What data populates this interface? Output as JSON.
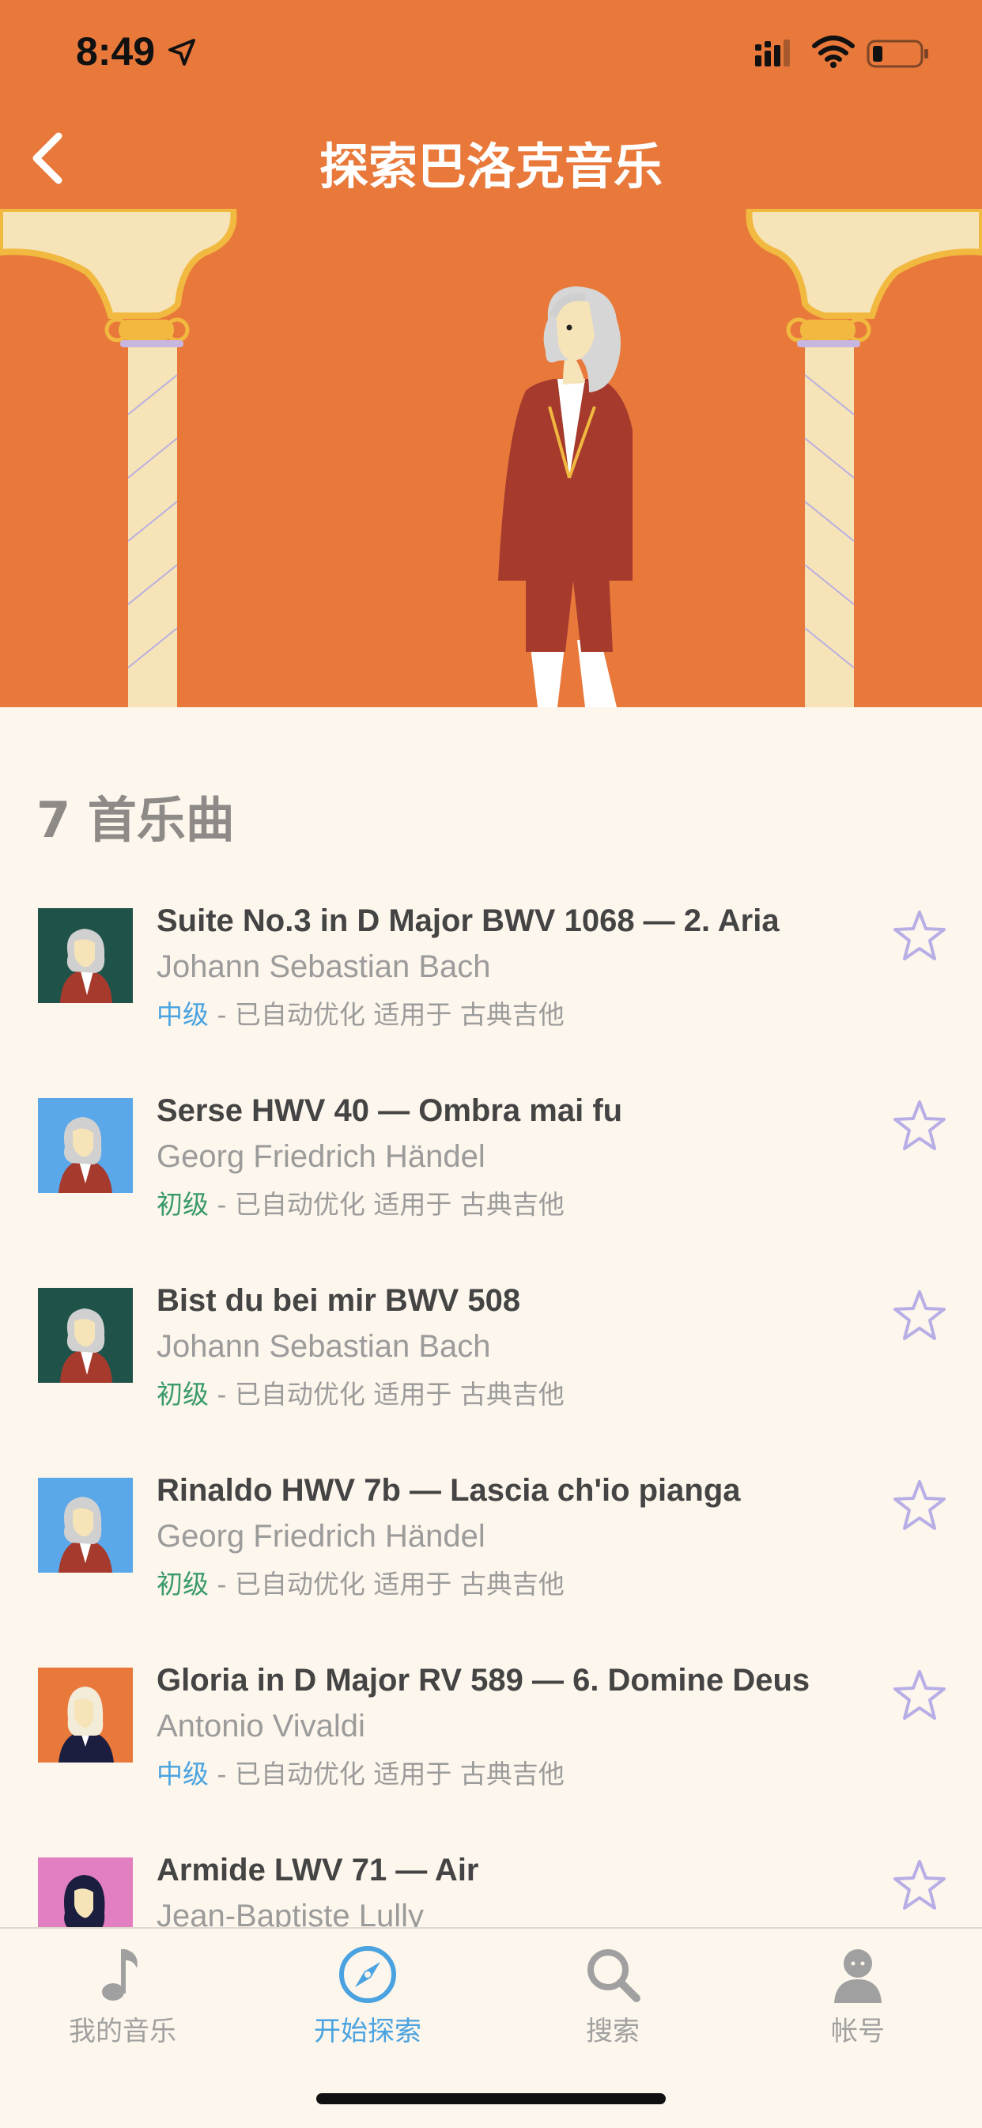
{
  "status": {
    "time": "8:49",
    "icons": [
      "location-arrow-icon",
      "signal-icon",
      "wifi-icon",
      "battery-icon"
    ]
  },
  "nav": {
    "title": "探索巴洛克音乐",
    "back_icon": "chevron-left-icon"
  },
  "list": {
    "count_label": "7 首乐曲",
    "tracks": [
      {
        "title": "Suite No.3 in D Major BWV 1068 — 2. Aria",
        "composer": "Johann Sebastian Bach",
        "level": "中级",
        "meta": " - 已自动优化 适用于 古典吉他"
      },
      {
        "title": "Serse HWV 40 — Ombra mai fu",
        "composer": "Georg Friedrich Händel",
        "level": "初级",
        "meta": " - 已自动优化 适用于 古典吉他"
      },
      {
        "title": "Bist du bei mir BWV 508",
        "composer": "Johann Sebastian Bach",
        "level": "初级",
        "meta": " - 已自动优化 适用于 古典吉他"
      },
      {
        "title": "Rinaldo HWV 7b — Lascia ch'io pianga",
        "composer": "Georg Friedrich Händel",
        "level": "初级",
        "meta": " - 已自动优化 适用于 古典吉他"
      },
      {
        "title": "Gloria in D Major RV 589 — 6. Domine Deus",
        "composer": "Antonio Vivaldi",
        "level": "中级",
        "meta": " - 已自动优化 适用于 古典吉他"
      },
      {
        "title": "Armide LWV 71 — Air",
        "composer": "Jean-Baptiste Lully",
        "level": "",
        "meta": ""
      }
    ]
  },
  "tabs": [
    {
      "label": "我的音乐",
      "icon": "music-note-icon"
    },
    {
      "label": "开始探索",
      "icon": "compass-icon"
    },
    {
      "label": "搜索",
      "icon": "search-icon"
    },
    {
      "label": "帐号",
      "icon": "account-icon"
    }
  ],
  "colors": {
    "accent": "#e8793b",
    "background": "#fdf6ec",
    "intermediate": "#4aa3e0",
    "beginner": "#3a9a6b",
    "star": "#b7aee6"
  }
}
